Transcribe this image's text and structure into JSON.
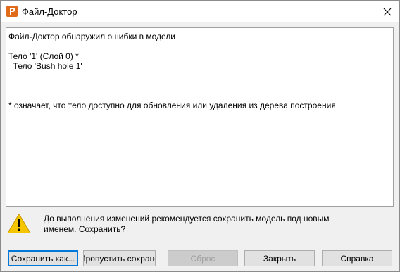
{
  "window": {
    "title": "Файл-Доктор",
    "icon": "app-logo-icon"
  },
  "report": {
    "lines": [
      "Файл-Доктор обнаружил ошибки в модели",
      "",
      "Тело '1' (Слой 0) *",
      "  Тело 'Bush hole 1'",
      "",
      "",
      "",
      "* означает, что тело доступно для обновления или удаления из дерева построения"
    ]
  },
  "warning": {
    "icon": "warning-icon",
    "line1": "До выполнения изменений рекомендуется сохранить модель под новым",
    "line2": "именем. Сохранить?"
  },
  "buttons": {
    "save_as": "Сохранить как...",
    "skip_save": "Пропустить сохранение",
    "reset": "Сброс",
    "close": "Закрыть",
    "help": "Справка"
  },
  "colors": {
    "accent": "#0078d7",
    "logo": "#e06c1a",
    "warning": "#f5c500"
  }
}
